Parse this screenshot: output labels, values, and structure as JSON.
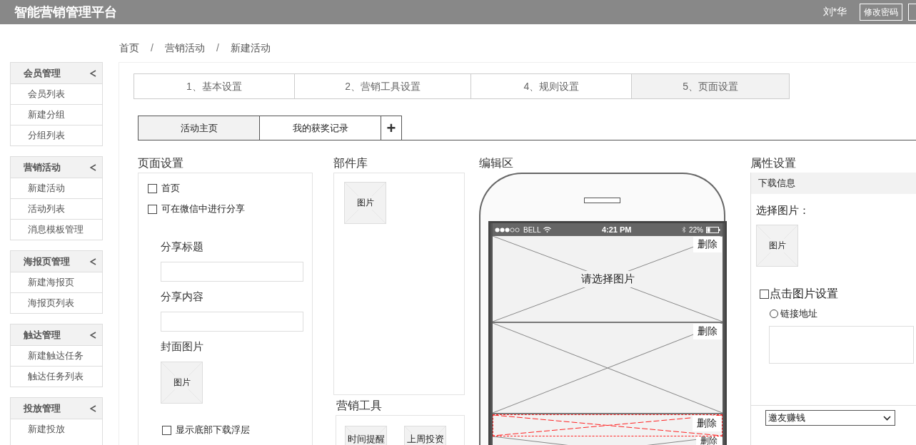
{
  "header": {
    "title": "智能营销管理平台",
    "user": "刘*华",
    "change_password": "修改密码"
  },
  "breadcrumb": [
    {
      "kind": "link",
      "text": "首页"
    },
    {
      "kind": "separator",
      "text": "/"
    },
    {
      "kind": "link",
      "text": "营销活动"
    },
    {
      "kind": "separator",
      "text": "/"
    },
    {
      "kind": "link",
      "text": "新建活动"
    }
  ],
  "sidebar": [
    {
      "title": "会员管理",
      "items": [
        "会员列表",
        "新建分组",
        "分组列表"
      ]
    },
    {
      "title": "营销活动",
      "items": [
        "新建活动",
        "活动列表",
        "消息模板管理"
      ]
    },
    {
      "title": "海报页管理",
      "items": [
        "新建海报页",
        "海报页列表"
      ]
    },
    {
      "title": "触达管理",
      "items": [
        "新建触达任务",
        "触达任务列表"
      ]
    },
    {
      "title": "投放管理",
      "items": [
        "新建投放"
      ]
    }
  ],
  "steps": [
    {
      "label": "1、基本设置",
      "selected": false
    },
    {
      "label": "2、营销工具设置",
      "selected": false
    },
    {
      "label": "4、规则设置",
      "selected": false
    },
    {
      "label": "5、页面设置",
      "selected": true
    }
  ],
  "page_tabs": [
    {
      "label": "活动主页",
      "selected": true
    },
    {
      "label": "我的获奖记录",
      "selected": false
    }
  ],
  "add_tab": "+",
  "page_settings": {
    "title": "页面设置",
    "checkboxes": [
      {
        "label": "首页",
        "checked": false
      },
      {
        "label": "可在微信中进行分享",
        "checked": false
      }
    ],
    "share_title": "分享标题",
    "share_content": "分享内容",
    "cover_label": "封面图片",
    "cover_image": "图片",
    "footer_checkbox": {
      "label": "显示底部下载浮层",
      "checked": false
    }
  },
  "components": {
    "title": "部件库",
    "items": [
      "图片"
    ]
  },
  "tools": {
    "title": "营销工具",
    "items": [
      "时间提醒",
      "上周投资"
    ]
  },
  "editor": {
    "title": "编辑区",
    "status": {
      "carrier": "BELL",
      "time": "4:21 PM",
      "battery": "22%"
    },
    "blocks": [
      {
        "label": "请选择图片",
        "delete": "删除",
        "selected": false
      },
      {
        "delete": "删除",
        "selected": false
      },
      {
        "delete": "删除",
        "selected": true
      },
      {
        "delete": "删除",
        "selected": false
      }
    ]
  },
  "properties": {
    "title": "属性设置",
    "section": "下载信息",
    "choose_label": "选择图片：",
    "image": "图片",
    "click_setting": {
      "label": "点击图片设置",
      "checked": false
    },
    "link_radio": {
      "label": "链接地址",
      "selected": false
    },
    "dropdown": "邀友赚钱"
  }
}
